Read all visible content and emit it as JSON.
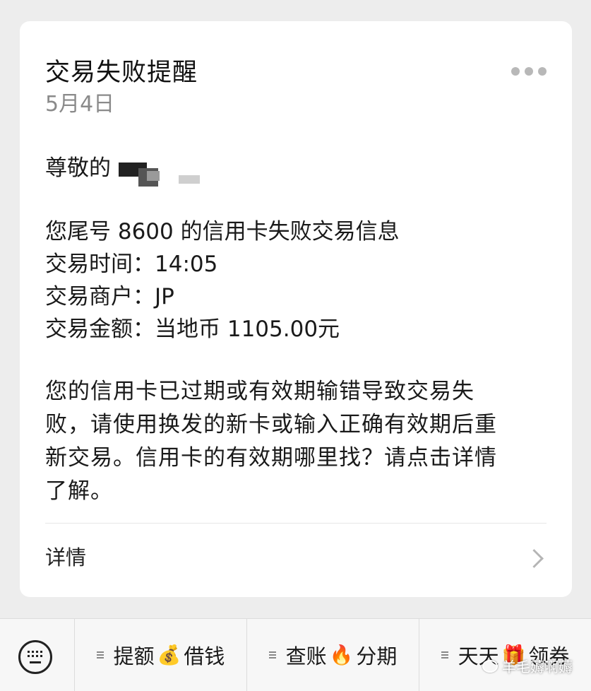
{
  "message": {
    "title": "交易失败提醒",
    "date": "5月4日",
    "greeting": "尊敬的",
    "lines": [
      "您尾号 8600 的信用卡失败交易信息",
      "交易时间：14:05",
      "交易商户：JP",
      "交易金额：当地币 1105.00元"
    ],
    "paragraph": "您的信用卡已过期或有效期输错导致交易失败，请使用换发的新卡或输入正确有效期后重新交易。信用卡的有效期哪里找？请点击详情了解。",
    "detail_label": "详情"
  },
  "bottom_menu": {
    "items": [
      {
        "label_a": "提额",
        "emoji": "💰",
        "label_b": "借钱"
      },
      {
        "label_a": "查账",
        "emoji": "🔥",
        "label_b": "分期"
      },
      {
        "label_a": "天天",
        "emoji": "🎁",
        "label_b": "领券"
      }
    ]
  },
  "watermark": {
    "text": "羊毛薅啊薅"
  },
  "colors": {
    "background": "#ededed",
    "card": "#ffffff",
    "date_gray": "#8a8a8a"
  }
}
